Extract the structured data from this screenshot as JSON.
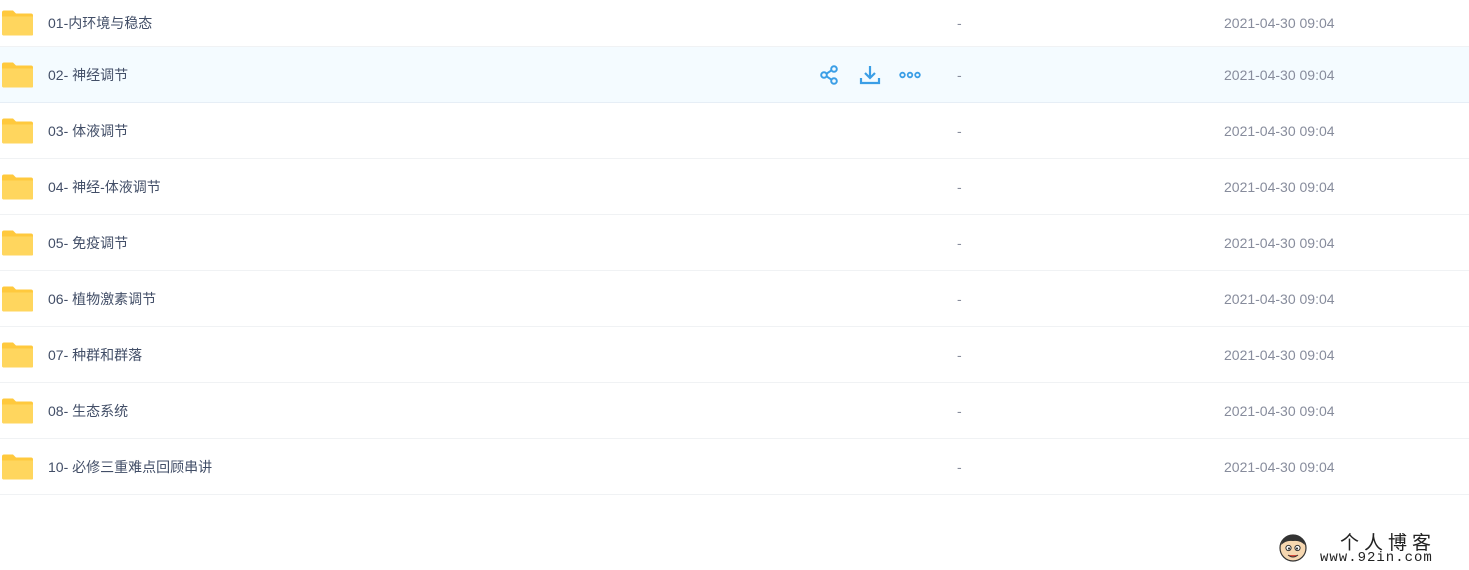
{
  "file_list": {
    "rows": [
      {
        "name": "01-内环境与稳态",
        "size": "-",
        "modified": "2021-04-30 09:04"
      },
      {
        "name": "02- 神经调节",
        "size": "-",
        "modified": "2021-04-30 09:04"
      },
      {
        "name": "03- 体液调节",
        "size": "-",
        "modified": "2021-04-30 09:04"
      },
      {
        "name": "04- 神经-体液调节",
        "size": "-",
        "modified": "2021-04-30 09:04"
      },
      {
        "name": "05- 免疫调节",
        "size": "-",
        "modified": "2021-04-30 09:04"
      },
      {
        "name": "06- 植物激素调节",
        "size": "-",
        "modified": "2021-04-30 09:04"
      },
      {
        "name": "07- 种群和群落",
        "size": "-",
        "modified": "2021-04-30 09:04"
      },
      {
        "name": "08- 生态系统",
        "size": "-",
        "modified": "2021-04-30 09:04"
      },
      {
        "name": "10- 必修三重难点回顾串讲",
        "size": "-",
        "modified": "2021-04-30 09:04"
      }
    ],
    "row_icon": "folder-icon",
    "hover_actions": [
      "share-icon",
      "download-icon",
      "more-icon"
    ]
  },
  "watermark": {
    "title": "个人博客",
    "url": "www.92in.com"
  },
  "colors": {
    "folder": "#ffd65e",
    "folder_tab": "#ffc93d",
    "accent": "#3a9ee6",
    "hover_row": "#f4fbff",
    "text": "#424e67",
    "muted": "#878c9c"
  }
}
